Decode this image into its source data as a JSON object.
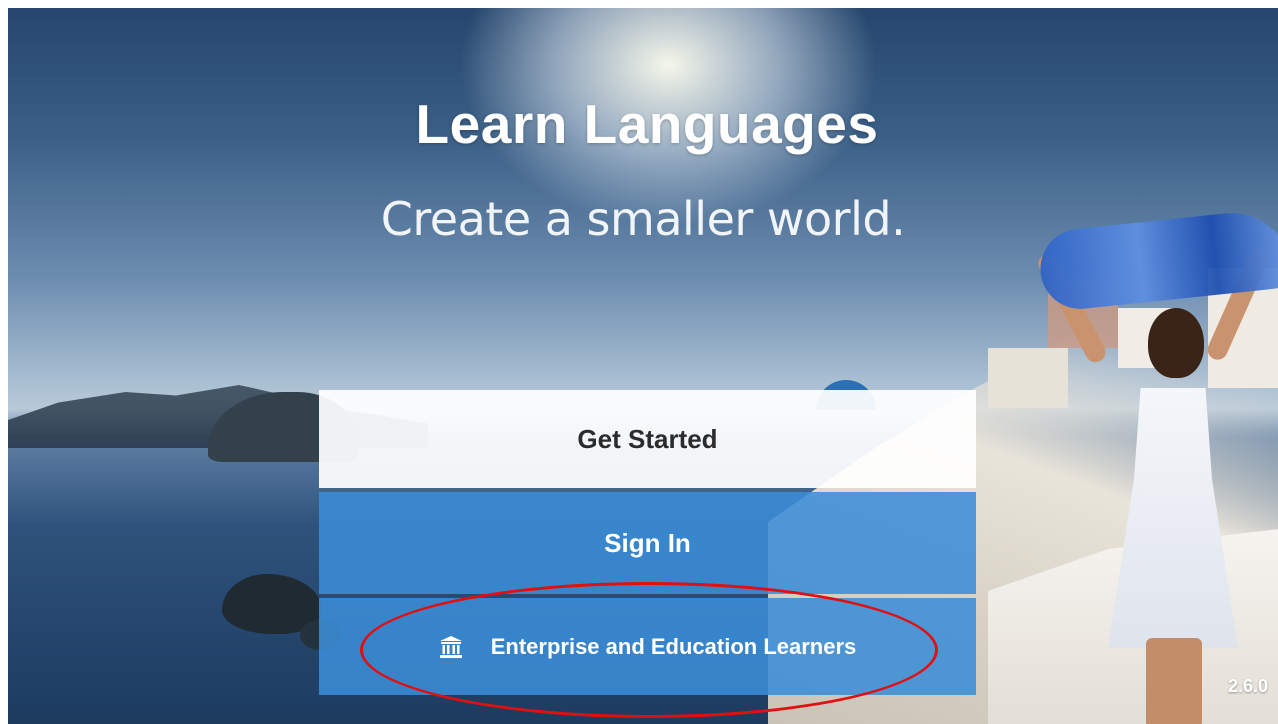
{
  "hero": {
    "title": "Learn Languages",
    "subtitle": "Create a smaller world."
  },
  "buttons": {
    "get_started": "Get Started",
    "sign_in": "Sign In",
    "enterprise": "Enterprise and Education Learners"
  },
  "icons": {
    "enterprise_icon": "bank-icon"
  },
  "version": "2.6.0",
  "colors": {
    "accent_blue": "#3b8dd7",
    "highlight": "#e01010"
  }
}
